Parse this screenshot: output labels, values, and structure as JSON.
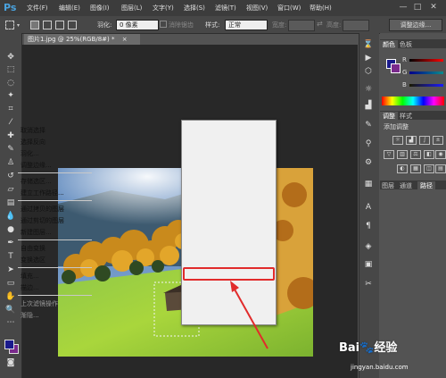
{
  "app": {
    "logo": "Ps"
  },
  "menu": [
    "文件(F)",
    "编辑(E)",
    "图像(I)",
    "图层(L)",
    "文字(Y)",
    "选择(S)",
    "滤镜(T)",
    "视图(V)",
    "窗口(W)",
    "帮助(H)"
  ],
  "window_controls": [
    "—",
    "□",
    "✕"
  ],
  "options": {
    "feather_label": "羽化:",
    "feather_value": "0 像素",
    "antialias_label": "消除锯齿",
    "style_label": "样式:",
    "style_value": "正常",
    "width_label": "宽度:",
    "height_label": "高度:",
    "refine_edge_button": "调整边缘..."
  },
  "document": {
    "tab_title": "图片1.jpg @ 25%(RGB/8#) *",
    "close": "×"
  },
  "context_menu": {
    "items": [
      {
        "label": "取消选择",
        "enabled": true
      },
      {
        "label": "选择反向",
        "enabled": true
      },
      {
        "label": "羽化...",
        "enabled": true
      },
      {
        "label": "调整边缘...",
        "enabled": true
      },
      {
        "label": "存储选区...",
        "enabled": true
      },
      {
        "label": "建立工作路径...",
        "enabled": true
      },
      {
        "label": "通过拷贝的图层",
        "enabled": true
      },
      {
        "label": "通过剪切的图层",
        "enabled": true
      },
      {
        "label": "新建图层...",
        "enabled": true
      },
      {
        "label": "自由变换",
        "enabled": true
      },
      {
        "label": "变换选区",
        "enabled": true
      },
      {
        "label": "填充...",
        "enabled": true,
        "highlighted": true
      },
      {
        "label": "描边...",
        "enabled": true
      },
      {
        "label": "上次滤镜操作",
        "enabled": false
      },
      {
        "label": "渐隐...",
        "enabled": false
      }
    ]
  },
  "panels": {
    "color_tabs": [
      "颜色",
      "色板"
    ],
    "color_channels": [
      "R",
      "G",
      "B"
    ],
    "adjust_tabs": [
      "调整",
      "样式"
    ],
    "adjust_title": "添加调整",
    "layers_tabs": [
      "图层",
      "通道",
      "路径"
    ]
  },
  "watermark": {
    "brand": "Bai",
    "brand_cn": "经验",
    "url": "jingyan.baidu.com"
  },
  "colors": {
    "highlight": "#e12b2b",
    "accent": "#4aa3df",
    "foreground_swatch": "#1a1a8c",
    "background_swatch": "#7a2a8c"
  }
}
